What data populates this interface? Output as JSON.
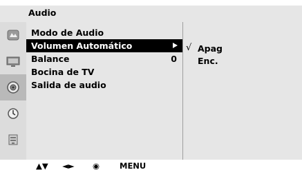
{
  "header": {
    "title": "Audio"
  },
  "sidebar": {
    "icons": [
      {
        "name": "picture-icon",
        "active": false
      },
      {
        "name": "tv-icon",
        "active": false
      },
      {
        "name": "audio-icon",
        "active": true
      },
      {
        "name": "clock-icon",
        "active": false
      },
      {
        "name": "settings-icon",
        "active": false
      }
    ]
  },
  "menu": {
    "items": [
      {
        "label": "Modo de Audio",
        "value": "",
        "has_arrow": false
      },
      {
        "label": "Volumen Automático",
        "value": "",
        "has_arrow": true
      },
      {
        "label": "Balance",
        "value": "0",
        "has_arrow": false
      },
      {
        "label": "Bocina de TV",
        "value": "",
        "has_arrow": false
      },
      {
        "label": "Salida de audio",
        "value": "",
        "has_arrow": false
      }
    ],
    "selected_index": 1
  },
  "options": {
    "items": [
      {
        "check": "√",
        "label": "Apag"
      },
      {
        "check": "",
        "label": "Enc."
      }
    ]
  },
  "footer": {
    "move_hint": "▲▼",
    "adjust_hint": "◄►",
    "ok_hint": "◉",
    "menu_hint": "MENU"
  }
}
